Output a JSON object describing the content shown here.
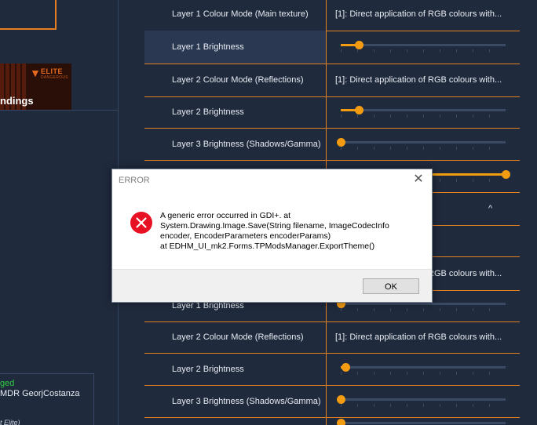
{
  "left_panel": {
    "banner_logo_text": "ELITE",
    "banner_logo_sub": "DANGEROUS",
    "banner_caption": "ndings",
    "status_tag": "ged",
    "commander": "MDR GeorjCostanza",
    "footer_text": "t Elite)"
  },
  "rows": [
    {
      "kind": "value",
      "label": "Layer 1 Colour Mode (Main texture)",
      "value": "[1]: Direct application of RGB colours with..."
    },
    {
      "kind": "slider",
      "label": "Layer 1 Brightness",
      "level": 0.11,
      "highlight": true
    },
    {
      "kind": "value",
      "label": "Layer 2 Colour Mode (Reflections)",
      "value": "[1]: Direct application of RGB colours with..."
    },
    {
      "kind": "slider",
      "label": "Layer 2 Brightness",
      "level": 0.11
    },
    {
      "kind": "slider",
      "label": "Layer 3 Brightness (Shadows/Gamma)",
      "level": 0.0
    },
    {
      "kind": "slider",
      "label": "",
      "level": 1.0
    },
    {
      "kind": "collapse",
      "label": "",
      "chevron": "^"
    },
    {
      "kind": "value",
      "label": "",
      "value": ""
    },
    {
      "kind": "value",
      "label": "",
      "value": "[1]: Direct application of RGB colours with..."
    },
    {
      "kind": "slider",
      "label": "Layer 1 Brightness",
      "level": 0.0
    },
    {
      "kind": "value",
      "label": "Layer 2 Colour Mode (Reflections)",
      "value": "[1]: Direct application of RGB colours with..."
    },
    {
      "kind": "slider",
      "label": "Layer 2 Brightness",
      "level": 0.03
    },
    {
      "kind": "slider",
      "label": "Layer 3 Brightness (Shadows/Gamma)",
      "level": 0.0
    },
    {
      "kind": "slider",
      "label": "",
      "level": 0.0
    }
  ],
  "dialog": {
    "title": "ERROR",
    "close_glyph": "✕",
    "icon": "error-icon",
    "message": "A generic error occurred in GDI+.    at System.Drawing.Image.Save(String filename, ImageCodecInfo encoder, EncoderParameters encoderParams)\n   at EDHM_UI_mk2.Forms.TPModsManager.ExportTheme()",
    "ok_label": "OK"
  },
  "colors": {
    "background": "#1f2a3d",
    "accent": "#e67e22",
    "slider": "#f39c12",
    "error_red": "#e81123"
  }
}
